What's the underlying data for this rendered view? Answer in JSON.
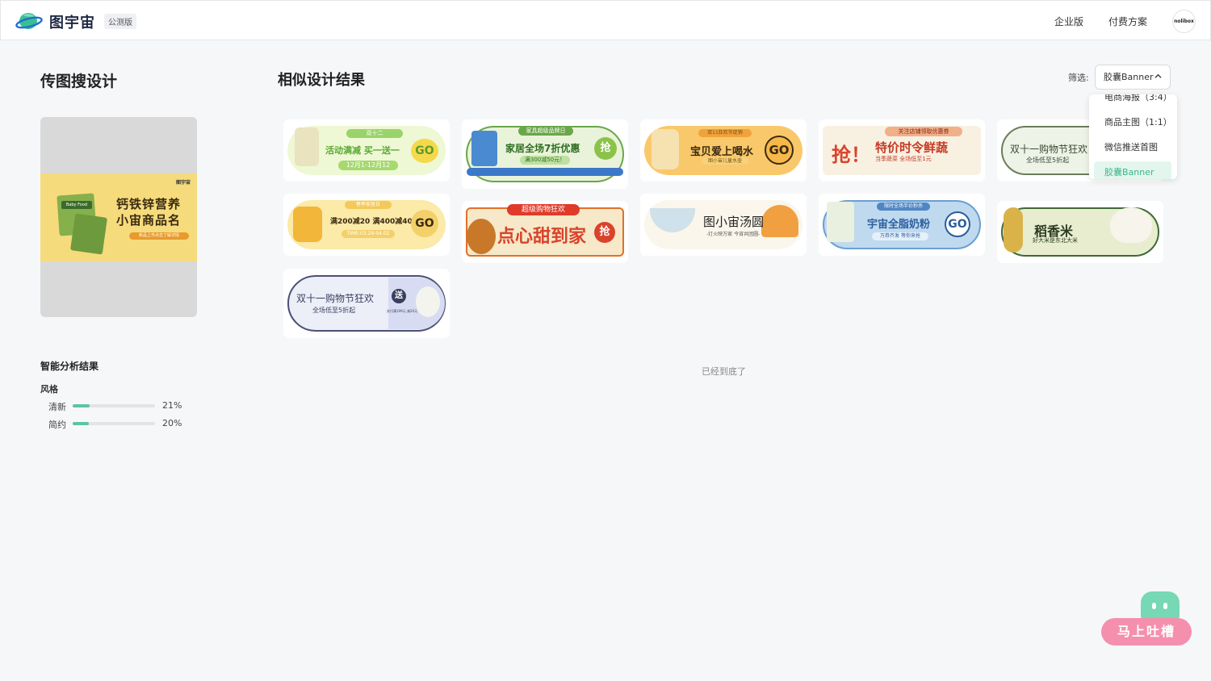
{
  "header": {
    "brand": "图宇宙",
    "beta_badge": "公测版",
    "nav": [
      "企业版",
      "付费方案"
    ],
    "avatar_text": "nolibox"
  },
  "left_panel": {
    "title": "传图搜设计",
    "preview": {
      "brand": "图宇宙",
      "package_label": "Baby Food",
      "line1": "钙铁锌营养",
      "line2": "小宙商品名",
      "pill": "新品上市点击了解详情"
    },
    "analysis_title": "智能分析结果",
    "style_label": "风格",
    "styles": [
      {
        "name": "清新",
        "percent": "21%",
        "value": 0.21
      },
      {
        "name": "简约",
        "percent": "20%",
        "value": 0.2
      }
    ]
  },
  "results": {
    "title": "相似设计结果",
    "filter_label": "筛选:",
    "filter_value": "胶囊Banner",
    "dropdown_options": [
      "电商海报（3:4）",
      "商品主图（1:1）",
      "微信推送首图",
      "胶囊Banner"
    ],
    "dropdown_selected": "胶囊Banner",
    "end_text": "已经到底了",
    "cards": [
      {
        "tag": "双十二",
        "main": "活动满减 买一送一",
        "sub": "12月1-12月12",
        "go": "GO"
      },
      {
        "tag": "家具超级品牌日",
        "main": "家居全场7折优惠",
        "sub": "满300减50元！",
        "go": "抢"
      },
      {
        "tag": "双11狂欢节促销",
        "main": "宝贝爱上喝水",
        "sub": "图小宙儿童水壶",
        "go": "GO"
      },
      {
        "tag": "关注店铺领取优惠券",
        "main": "特价时令鲜蔬",
        "sub": "当季蔬菜 全场低至1元",
        "go": "抢！"
      },
      {
        "tag": "",
        "main": "双十一购物节狂欢",
        "sub": "全场低至5折起",
        "go": ""
      },
      {
        "tag": "春季家居日",
        "main": "满200减20 满400减40",
        "sub": "TIME:03.29-04.02",
        "go": "GO"
      },
      {
        "tag": "超级购物狂欢",
        "main": "点心甜到家",
        "sub": "",
        "go": "抢"
      },
      {
        "tag": "",
        "main": "图小宙汤圆",
        "sub": "-灯火映万家 今宵共团圆-",
        "go": ""
      },
      {
        "tag": "限时全场半价秒杀",
        "main": "宇宙全脂奶粉",
        "sub": "万券齐发 等你来抢",
        "go": "GO"
      },
      {
        "tag": "",
        "main": "稻香米",
        "sub": "好大米是东北大米",
        "go": ""
      },
      {
        "tag": "",
        "main": "双十一购物节狂欢",
        "sub": "全场低至5折起",
        "go": "送",
        "extra": "实付满199元 减20元"
      }
    ]
  },
  "feedback": {
    "label": "马上吐槽"
  },
  "colors": {
    "accent": "#5cc4a2",
    "selected_bg": "#e3f6ee",
    "feedback_pink": "#f58fae",
    "feedback_green": "#76d8b4"
  }
}
